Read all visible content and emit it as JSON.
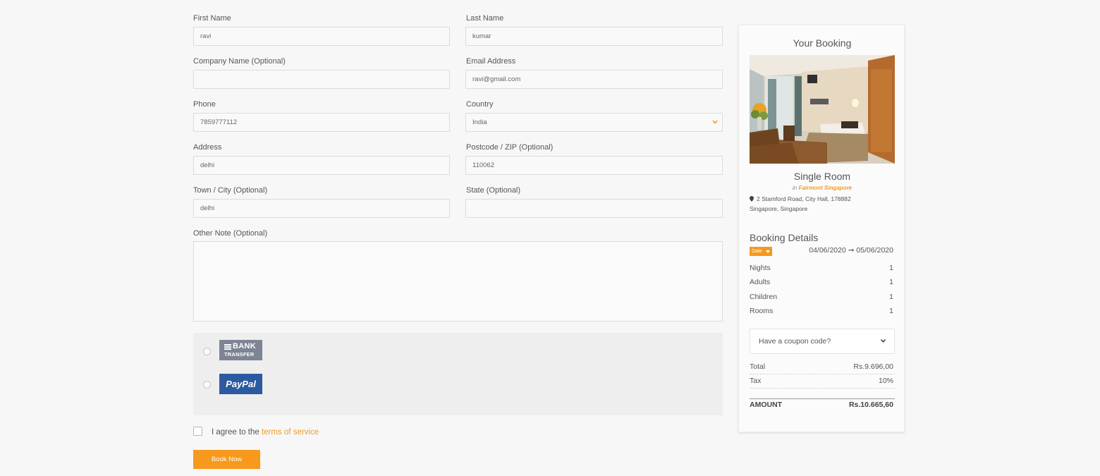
{
  "form": {
    "first_name": {
      "label": "First Name",
      "value": "ravi"
    },
    "last_name": {
      "label": "Last Name",
      "value": "kumar"
    },
    "company": {
      "label": "Company Name (Optional)",
      "value": ""
    },
    "email": {
      "label": "Email Address",
      "value": "ravi@gmail.com"
    },
    "phone": {
      "label": "Phone",
      "value": "7859777112"
    },
    "country": {
      "label": "Country",
      "value": "India"
    },
    "address": {
      "label": "Address",
      "value": "delhi"
    },
    "postcode": {
      "label": "Postcode / ZIP (Optional)",
      "value": "110062"
    },
    "town": {
      "label": "Town / City (Optional)",
      "value": "delhi"
    },
    "state": {
      "label": "State (Optional)",
      "value": ""
    },
    "note": {
      "label": "Other Note (Optional)",
      "value": ""
    }
  },
  "payment": {
    "bank": {
      "line1": "BANK",
      "line2": "TRANSFER",
      "color": "#7d8493"
    },
    "paypal": {
      "label": "PayPal",
      "color": "#2c5aa0"
    }
  },
  "agree": {
    "text": "I agree to the ",
    "link": "terms of service"
  },
  "book_button": "Book Now",
  "accent_color": "#f6991c",
  "sidebar": {
    "title": "Your Booking",
    "room_name": "Single Room",
    "in_prefix": "in ",
    "hotel": "Fairmont Singapore",
    "address_line1": "2 Stamford Road, City Hall, 178882",
    "address_line2": "Singapore, Singapore",
    "details_title": "Booking Details",
    "date_badge": "Date",
    "dates": "04/06/2020 ➞ 05/06/2020",
    "rows": [
      {
        "label": "Nights",
        "value": "1"
      },
      {
        "label": "Adults",
        "value": "1"
      },
      {
        "label": "Children",
        "value": "1"
      },
      {
        "label": "Rooms",
        "value": "1"
      }
    ],
    "coupon": "Have a coupon code?",
    "total_label": "Total",
    "total_value": "Rs.9.696,00",
    "tax_label": "Tax",
    "tax_value": "10%",
    "amount_label": "AMOUNT",
    "amount_value": "Rs.10.665,60"
  }
}
